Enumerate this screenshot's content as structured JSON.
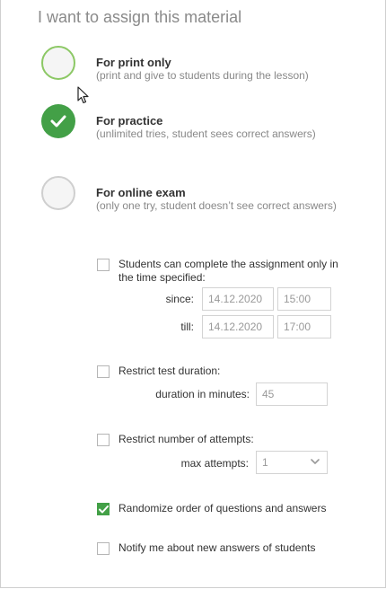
{
  "title": "I want to assign this material",
  "options": [
    {
      "title": "For print only",
      "desc": "(print and give to students during the lesson)"
    },
    {
      "title": "For practice",
      "desc": "(unlimited tries, student sees correct answers)"
    },
    {
      "title": "For online exam",
      "desc": "(only one try, student doesn’t see correct answers)"
    }
  ],
  "settings": {
    "time_limit_label": "Students can complete the assignment only in the time specified:",
    "since_label": "since:",
    "since_date": "14.12.2020",
    "since_time": "15:00",
    "till_label": "till:",
    "till_date": "14.12.2020",
    "till_time": "17:00",
    "duration_label": "Restrict test duration:",
    "duration_minutes_label": "duration in minutes:",
    "duration_minutes_placeholder": "45",
    "attempts_label": "Restrict number of attempts:",
    "max_attempts_label": "max attempts:",
    "max_attempts_value": "1",
    "randomize_label": "Randomize order of questions and answers",
    "notify_label": "Notify me about new answers of students"
  },
  "state": {
    "selected_option": "For practice",
    "time_limit_checked": false,
    "duration_checked": false,
    "attempts_checked": false,
    "randomize_checked": true,
    "notify_checked": false
  },
  "colors": {
    "accent": "#43a047",
    "hover_ring": "#8cc865"
  },
  "icons": {
    "check": "check-icon",
    "chevron": "chevron-down-icon",
    "cursor": "mouse-cursor-icon"
  }
}
